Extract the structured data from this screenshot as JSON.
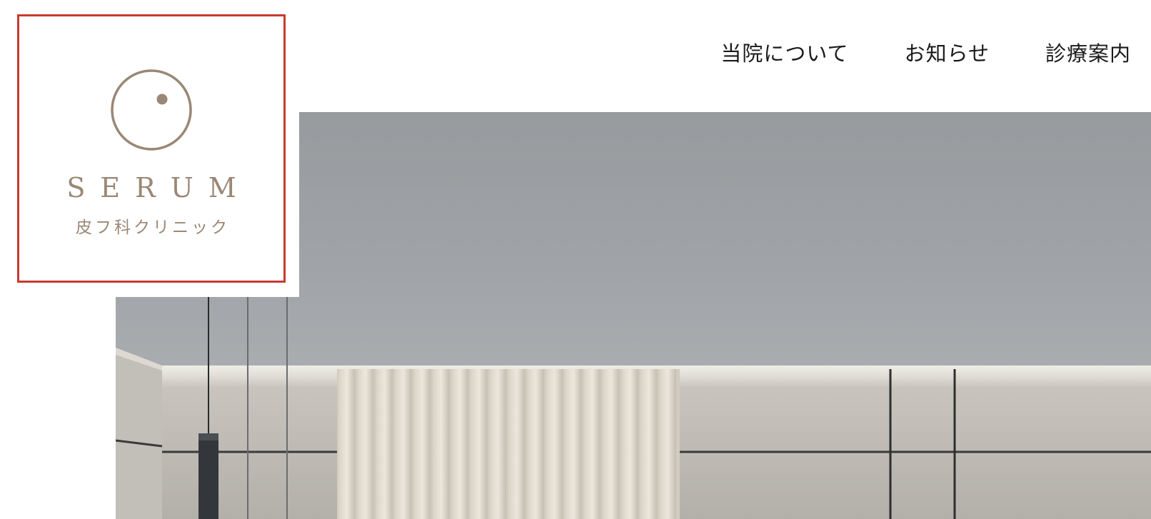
{
  "header": {
    "logo": {
      "name": "SERUM",
      "subtitle": "皮フ科クリニック",
      "icon": "circle-dot-logo-icon",
      "color": "#9a8775",
      "border_color": "#c93a2f"
    },
    "nav": [
      {
        "label": "当院について"
      },
      {
        "label": "お知らせ"
      },
      {
        "label": "診療案内"
      }
    ]
  },
  "hero": {
    "image": "clinic-interior-photo"
  }
}
